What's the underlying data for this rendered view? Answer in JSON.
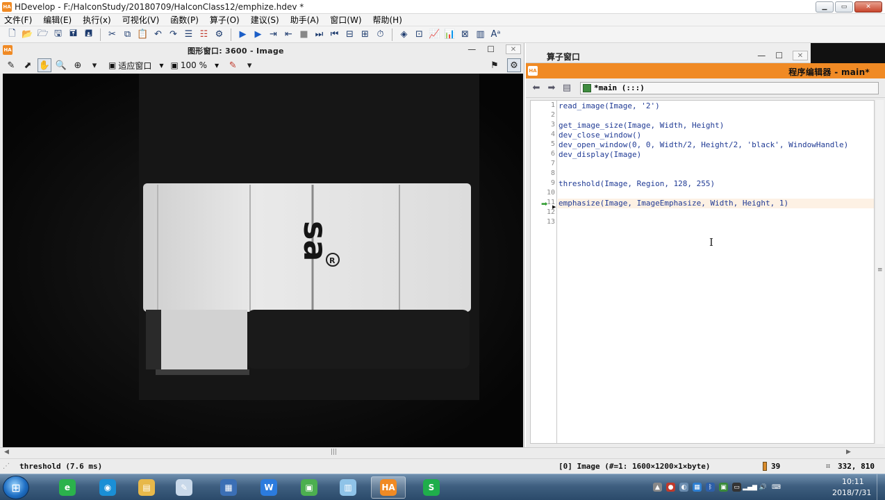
{
  "window": {
    "title": "HDevelop - F:/HalconStudy/20180709/HalconClass12/emphize.hdev *",
    "logo_text": "HA",
    "controls": {
      "minimize": "▁",
      "maximize": "▭",
      "close": "✕"
    }
  },
  "menu": [
    "文件(F)",
    "编辑(E)",
    "执行(x)",
    "可视化(V)",
    "函数(P)",
    "算子(O)",
    "建议(S)",
    "助手(A)",
    "窗口(W)",
    "帮助(H)"
  ],
  "graphics_window": {
    "title": "图形窗口: 3600 - Image",
    "zoom_mode": "适应窗口",
    "zoom_percent": "100 %",
    "controls": {
      "minimize": "—",
      "maximize": "☐",
      "close": "✕"
    }
  },
  "operator_window": {
    "title": "算子窗口",
    "controls": {
      "minimize": "—",
      "maximize": "☐",
      "close": "✕"
    }
  },
  "program_editor": {
    "title": "程序编辑器 - main*",
    "procedure": "*main (:::)",
    "line_numbers": [
      "1",
      "2",
      "3",
      "4",
      "5",
      "6",
      "7",
      "8",
      "9",
      "10",
      "11",
      "12",
      "13"
    ],
    "lines": [
      "read_image(Image, '2')",
      "",
      "get_image_size(Image, Width, Height)",
      "dev_close_window()",
      "dev_open_window(0, 0, Width/2, Height/2, 'black', WindowHandle)",
      "dev_display(Image)",
      "",
      "",
      "threshold(Image, Region, 128, 255)",
      "",
      "emphasize(Image, ImageEmphasize, Width, Height, 1)",
      "",
      ""
    ],
    "current_line": 11,
    "code_color": "#1f3a94"
  },
  "status": {
    "last_operator": "threshold (7.6 ms)",
    "image_info": "[0] Image (#=1: 1600×1200×1×byte)",
    "gray_value": "39",
    "coordinates": "332, 810"
  },
  "taskbar": {
    "apps": [
      {
        "name": "browser-360",
        "color": "#2bb24c",
        "glyph": "e"
      },
      {
        "name": "qq-video",
        "color": "#1a8fd6",
        "glyph": "◉"
      },
      {
        "name": "file-explorer",
        "color": "#e7b84a",
        "glyph": "▤"
      },
      {
        "name": "paint",
        "color": "#c9d9ea",
        "glyph": "✎"
      },
      {
        "name": "screen-capture",
        "color": "#3b6fb5",
        "glyph": "▦"
      },
      {
        "name": "wps-writer",
        "color": "#2b7bde",
        "glyph": "W"
      },
      {
        "name": "notes",
        "color": "#4caf50",
        "glyph": "▣"
      },
      {
        "name": "virtual-machine",
        "color": "#8fc3e8",
        "glyph": "▥"
      },
      {
        "name": "hdevelop",
        "color": "#f08a24",
        "glyph": "HA"
      },
      {
        "name": "wps-spreadsheet",
        "color": "#1fae4b",
        "glyph": "S"
      }
    ],
    "time": "10:11",
    "date": "2018/7/31"
  },
  "colors": {
    "accent_orange": "#f08a24",
    "image_background": "#070707"
  }
}
